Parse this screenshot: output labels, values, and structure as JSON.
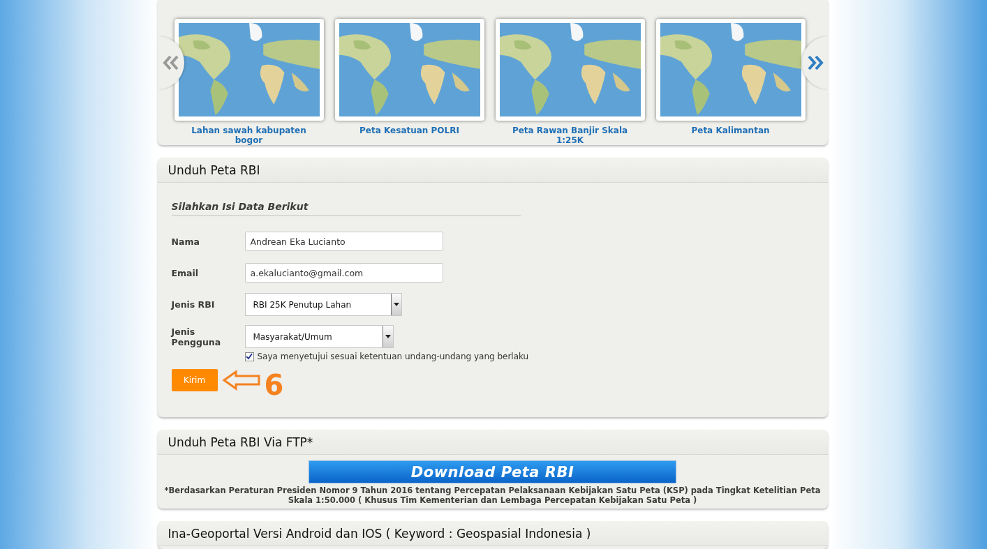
{
  "carousel": {
    "items": [
      {
        "kind": "picture",
        "caption": "Lahan sawah kabupaten bogor"
      },
      {
        "kind": "picture",
        "caption": "Peta Kesatuan POLRI"
      },
      {
        "kind": "picture",
        "caption": "Peta Rawan Banjir Skala 1:25K"
      },
      {
        "kind": "picture",
        "caption": "Peta Kalimantan"
      }
    ]
  },
  "download_form": {
    "title": "Unduh Peta RBI",
    "subtitle": "Silahkan Isi Data Berikut",
    "fields": [
      {
        "kind": "text",
        "label": "Nama",
        "value": "Andrean Eka Lucianto"
      },
      {
        "kind": "text",
        "label": "Email",
        "value": "a.ekalucianto@gmail.com"
      },
      {
        "kind": "select",
        "label": "Jenis RBI",
        "value": "RBI 25K Penutup Lahan"
      },
      {
        "kind": "select",
        "label": "Jenis Pengguna",
        "value": "Masyarakat/Umum"
      }
    ],
    "agreement": {
      "label": "Saya menyetujui sesuai ketentuan undang-undang yang berlaku",
      "checked": true
    },
    "submit": "Kirim",
    "annotation": {
      "label": "6"
    }
  },
  "ftp_panel": {
    "title": "Unduh Peta RBI Via FTP*",
    "button": "Download Peta RBI",
    "note": "*Berdasarkan Peraturan Presiden Nomor 9 Tahun 2016 tentang Percepatan Pelaksanaan Kebijakan Satu Peta (KSP) pada Tingkat Ketelitian Peta Skala 1:50.000 ( Khusus Tim Kementerian dan Lembaga Percepatan Kebijakan Satu Peta )"
  },
  "mobile_panel": {
    "title": "Ina-Geoportal Versi Android dan IOS ( Keyword : Geospasial Indonesia )"
  }
}
